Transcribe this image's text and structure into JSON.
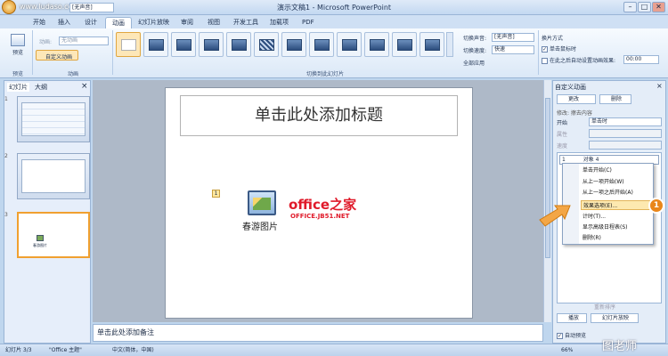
{
  "window": {
    "title": "演示文稿1 - Microsoft PowerPoint",
    "watermark": "www.ludaso.com",
    "min": "–",
    "max": "□",
    "close": "✕"
  },
  "quick_access": {
    "sound_combo": "[无声音]"
  },
  "tabs": [
    "开始",
    "插入",
    "设计",
    "动画",
    "幻灯片放映",
    "审阅",
    "视图",
    "开发工具",
    "加载项",
    "PDF"
  ],
  "ribbon": {
    "preview": {
      "label": "预览",
      "group": "预览"
    },
    "animation": {
      "animate_label": "动画:",
      "animate_value": "无动画",
      "custom_label": "自定义动画",
      "group": "动画"
    },
    "transition_group": "切换到此幻灯片",
    "sound": {
      "label": "切换声音:",
      "value": "[无声音]"
    },
    "speed": {
      "label": "切换速度:",
      "value": "快速"
    },
    "apply_all": "全部应用",
    "advance": {
      "title": "换片方式",
      "on_click": "单击鼠标时",
      "auto": "在此之后自动设置动画效果:",
      "time": "00:00"
    }
  },
  "left_pane": {
    "tab_slides": "幻灯片",
    "tab_outline": "大纲",
    "close": "×",
    "thumbs": [
      "1",
      "2",
      "3"
    ],
    "thumb3_caption": "春游图片"
  },
  "slide": {
    "title_placeholder": "单击此处添加标题",
    "anim_marker": "1",
    "image_caption": "春游图片",
    "logo_main": "office之家",
    "logo_sub": "OFFICE.JB51.NET"
  },
  "notes": {
    "placeholder": "单击此处添加备注"
  },
  "custom_anim": {
    "title": "自定义动画",
    "change": "更改",
    "delete": "删除",
    "modify": "修改: 擦去内容",
    "start_label": "开始",
    "start_value": "单击时",
    "prop_label": "属性",
    "speed_label": "速度",
    "item": "对象 4",
    "item_num": "1",
    "reorder": "重新排序",
    "play": "播放",
    "slideshow": "幻灯片放映",
    "autopreview": "自动预览"
  },
  "context_menu": [
    "单击开始(C)",
    "从上一项开始(W)",
    "从上一项之后开始(A)",
    "效果选项(E)...",
    "计时(T)...",
    "显示高级日程表(S)",
    "删除(R)"
  ],
  "callout": {
    "number": "1"
  },
  "status": {
    "slide": "幻灯片 3/3",
    "theme": "\"Office 主题\"",
    "lang": "中文(简体，中国)",
    "zoom": "66%",
    "brand": "图老师"
  },
  "colors": {
    "accent": "#f0a030",
    "highlight": "#fde9b0",
    "ribbon": "#dbe8f7"
  }
}
